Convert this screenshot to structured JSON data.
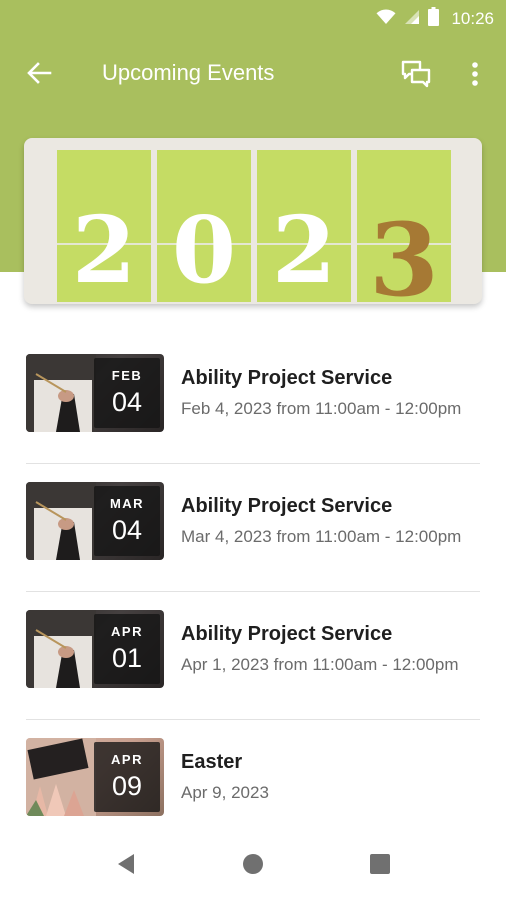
{
  "colors": {
    "header": "#a9bf5e",
    "tile": "#c5dc64",
    "accent_digit": "#a67934",
    "banner_bg": "#ebe8e2"
  },
  "status_bar": {
    "time": "10:26",
    "icons": [
      "wifi-icon",
      "signal-icon",
      "battery-icon"
    ]
  },
  "app_bar": {
    "title": "Upcoming Events",
    "icons": [
      "back-arrow-icon",
      "chat-icon",
      "more-vert-icon"
    ]
  },
  "banner": {
    "digits": [
      "2",
      "0",
      "2",
      "3"
    ]
  },
  "events": [
    {
      "month": "FEB",
      "day": "04",
      "title": "Ability Project Service",
      "date": "Feb 4, 2023 from 11:00am - 12:00pm"
    },
    {
      "month": "MAR",
      "day": "04",
      "title": "Ability Project Service",
      "date": "Mar 4, 2023 from 11:00am - 12:00pm"
    },
    {
      "month": "APR",
      "day": "01",
      "title": "Ability Project Service",
      "date": "Apr 1, 2023 from 11:00am - 12:00pm"
    },
    {
      "month": "APR",
      "day": "09",
      "title": "Easter",
      "date": "Apr 9, 2023"
    }
  ],
  "nav_bar": {
    "icons": [
      "back-triangle-icon",
      "home-circle-icon",
      "recents-square-icon"
    ]
  }
}
